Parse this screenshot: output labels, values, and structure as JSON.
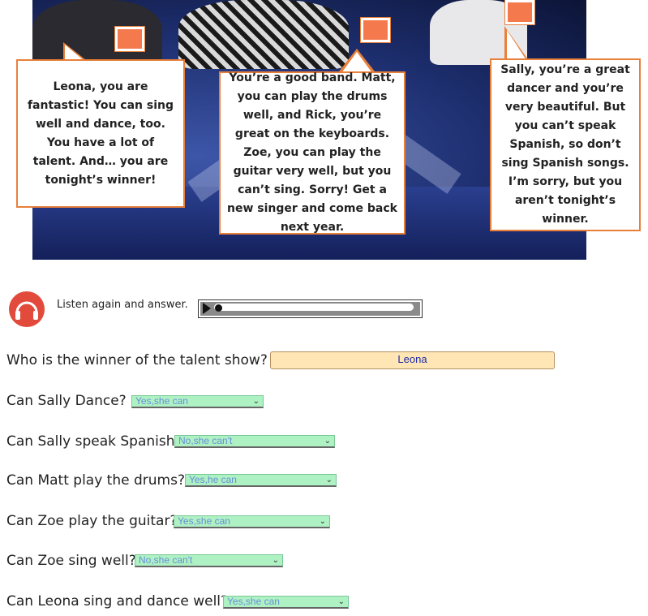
{
  "bubbles": {
    "left": "Leona, you are fantastic! You can sing well and dance, too. You have a lot of talent. And… you are tonight’s winner!",
    "middle": "You’re a good band. Matt, you can play the drums well, and Rick, you’re great on the keyboards. Zoe, you can play the guitar very well, but you can’t sing. Sorry! Get a new singer and come back next year.",
    "right": "Sally, you’re a great dancer and you’re very beautiful. But you can’t speak Spanish, so don’t sing Spanish songs. I’m sorry, but you aren’t tonight’s winner."
  },
  "listen": {
    "instruction": "Listen again and answer.",
    "progress": 0.0
  },
  "questions": {
    "q1": {
      "text": "Who is the winner of the talent show?",
      "answer": "Leona"
    },
    "q2": {
      "text": "Can Sally Dance?",
      "answer": "Yes,she can"
    },
    "q3": {
      "text": "Can Sally speak Spanish?",
      "answer": "No,she can't"
    },
    "q4": {
      "text": "Can Matt play the drums?",
      "answer": "Yes,he can"
    },
    "q5": {
      "text": "Can Zoe play the guitar?",
      "answer": "Yes,she can"
    },
    "q6": {
      "text": "Can Zoe sing well?",
      "answer": "No,she can't"
    },
    "q7": {
      "text": "Can Leona sing and dance well?",
      "answer": "Yes,she can"
    }
  },
  "colors": {
    "accent": "#e8803a",
    "input_bg": "#ffe6b4",
    "select_bg": "#aef2c4",
    "icon_red": "#e24b3b"
  },
  "icons": {
    "listen": "headphones-icon",
    "play": "play-icon",
    "dropdown": "chevron-down-icon"
  }
}
